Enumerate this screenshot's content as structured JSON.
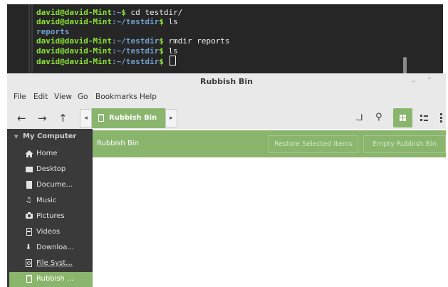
{
  "terminal": {
    "lines": [
      {
        "prompt_host": "david@david-Mint",
        "prompt_path": ":~",
        "symbol": "$",
        "command": " cd testdir/"
      },
      {
        "prompt_host": "david@david-Mint",
        "prompt_path": ":~/testdir",
        "symbol": "$",
        "command": " ls"
      },
      {
        "output": "reports"
      },
      {
        "prompt_host": "david@david-Mint",
        "prompt_path": ":~/testdir",
        "symbol": "$",
        "command": " rmdir reports"
      },
      {
        "prompt_host": "david@david-Mint",
        "prompt_path": ":~/testdir",
        "symbol": "$",
        "command": " ls"
      },
      {
        "prompt_host": "david@david-Mint",
        "prompt_path": ":~/testdir",
        "symbol": "$",
        "command": " "
      }
    ]
  },
  "window": {
    "title": "Rubbish Bin",
    "minimize_glyph": "–",
    "maximize_glyph": "˄"
  },
  "menubar": {
    "items": [
      "File",
      "Edit",
      "View",
      "Go",
      "Bookmarks",
      "Help"
    ]
  },
  "toolbar": {
    "back_glyph": "←",
    "forward_glyph": "→",
    "up_glyph": "↑",
    "path_left_glyph": "◂",
    "path_right_glyph": "▸",
    "path_crumb": "Rubbish Bin",
    "search_glyph": "⚲",
    "toggle_location_glyph": ".⅃"
  },
  "sidebar": {
    "section": "My Computer",
    "items": [
      {
        "label": "Home",
        "icon": "home-icon"
      },
      {
        "label": "Desktop",
        "icon": "desktop-icon"
      },
      {
        "label": "Docume...",
        "icon": "documents-icon"
      },
      {
        "label": "Music",
        "icon": "music-icon",
        "glyph": "♫"
      },
      {
        "label": "Pictures",
        "icon": "pictures-icon"
      },
      {
        "label": "Videos",
        "icon": "videos-icon"
      },
      {
        "label": "Downloa...",
        "icon": "downloads-icon",
        "glyph": "⬇"
      },
      {
        "label": "File Syst...",
        "icon": "drive-icon"
      },
      {
        "label": "Rubbish ...",
        "icon": "trash-icon",
        "active": true
      }
    ]
  },
  "content": {
    "info_label": "Rubbish Bin",
    "restore_button": "Restore Selected Items",
    "empty_button": "Empty Rubbish Bin"
  },
  "colors": {
    "accent": "#8ab56d",
    "sidebar_bg": "#3a3a3a",
    "terminal_bg": "#262626"
  }
}
